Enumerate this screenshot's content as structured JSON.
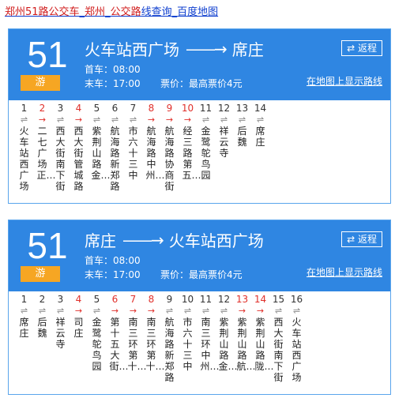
{
  "page_link": {
    "part1": "郑州51路公交车",
    "sep1": "_",
    "part2": "郑州",
    "sep2": "_",
    "part3": "公交路",
    "part4": "线查询",
    "sep3": "_",
    "part5": "百度地图"
  },
  "cards": [
    {
      "route_number": "51",
      "route_tag": "游",
      "from": "火车站西广场",
      "to": "席庄",
      "arrow": "——→",
      "first_bus": "首车：08:00",
      "last_bus": "末车：17:00",
      "fare": "票价：最高票价4元",
      "reverse_label": "⇄ 返程",
      "map_link": "在地图上显示路线",
      "stops": [
        {
          "num": "1",
          "mark": "⇌",
          "name": "火车站西广场",
          "red": false
        },
        {
          "num": "2",
          "mark": "→",
          "name": "二七广场正…",
          "red": true
        },
        {
          "num": "3",
          "mark": "⇌",
          "name": "西大街南下街",
          "red": false
        },
        {
          "num": "4",
          "mark": "→",
          "name": "西大街管城路",
          "red": true
        },
        {
          "num": "5",
          "mark": "⇌",
          "name": "紫荆山路金…",
          "red": false
        },
        {
          "num": "6",
          "mark": "⇌",
          "name": "航海路新郑路",
          "red": false
        },
        {
          "num": "7",
          "mark": "⇌",
          "name": "市六十三中",
          "red": false
        },
        {
          "num": "8",
          "mark": "→",
          "name": "航海路中州…",
          "red": true
        },
        {
          "num": "9",
          "mark": "→",
          "name": "航海路协商街",
          "red": true
        },
        {
          "num": "10",
          "mark": "→",
          "name": "经三路第五…",
          "red": true
        },
        {
          "num": "11",
          "mark": "⇌",
          "name": "金鹭鸵鸟园",
          "red": false
        },
        {
          "num": "12",
          "mark": "⇌",
          "name": "祥云寺",
          "red": false
        },
        {
          "num": "13",
          "mark": "⇌",
          "name": "后魏",
          "red": false
        },
        {
          "num": "14",
          "mark": "⇌",
          "name": "席庄",
          "red": false
        }
      ]
    },
    {
      "route_number": "51",
      "route_tag": "游",
      "from": "席庄",
      "to": "火车站西广场",
      "arrow": "——→",
      "first_bus": "首车：08:00",
      "last_bus": "末车：17:00",
      "fare": "票价：最高票价4元",
      "reverse_label": "⇄ 返程",
      "map_link": "在地图上显示路线",
      "stops": [
        {
          "num": "1",
          "mark": "⇌",
          "name": "席庄",
          "red": false
        },
        {
          "num": "2",
          "mark": "⇌",
          "name": "后魏",
          "red": false
        },
        {
          "num": "3",
          "mark": "⇌",
          "name": "祥云寺",
          "red": false
        },
        {
          "num": "4",
          "mark": "→",
          "name": "司庄",
          "red": true
        },
        {
          "num": "5",
          "mark": "⇌",
          "name": "金鹭鸵鸟园",
          "red": false
        },
        {
          "num": "6",
          "mark": "→",
          "name": "第十五大街…",
          "red": true
        },
        {
          "num": "7",
          "mark": "→",
          "name": "南三环第十…",
          "red": true
        },
        {
          "num": "8",
          "mark": "→",
          "name": "南三环第十…",
          "red": true
        },
        {
          "num": "9",
          "mark": "⇌",
          "name": "航海路新郑路",
          "red": false
        },
        {
          "num": "10",
          "mark": "⇌",
          "name": "市六十三中",
          "red": false
        },
        {
          "num": "11",
          "mark": "⇌",
          "name": "南三环中州…",
          "red": false
        },
        {
          "num": "12",
          "mark": "⇌",
          "name": "紫荆山路金…",
          "red": false
        },
        {
          "num": "13",
          "mark": "→",
          "name": "紫荆山路航…",
          "red": true
        },
        {
          "num": "14",
          "mark": "→",
          "name": "紫荆山路陇…",
          "red": true
        },
        {
          "num": "15",
          "mark": "⇌",
          "name": "西大街南下街",
          "red": false
        },
        {
          "num": "16",
          "mark": "⇌",
          "name": "火车站西广场",
          "red": false
        }
      ]
    }
  ]
}
